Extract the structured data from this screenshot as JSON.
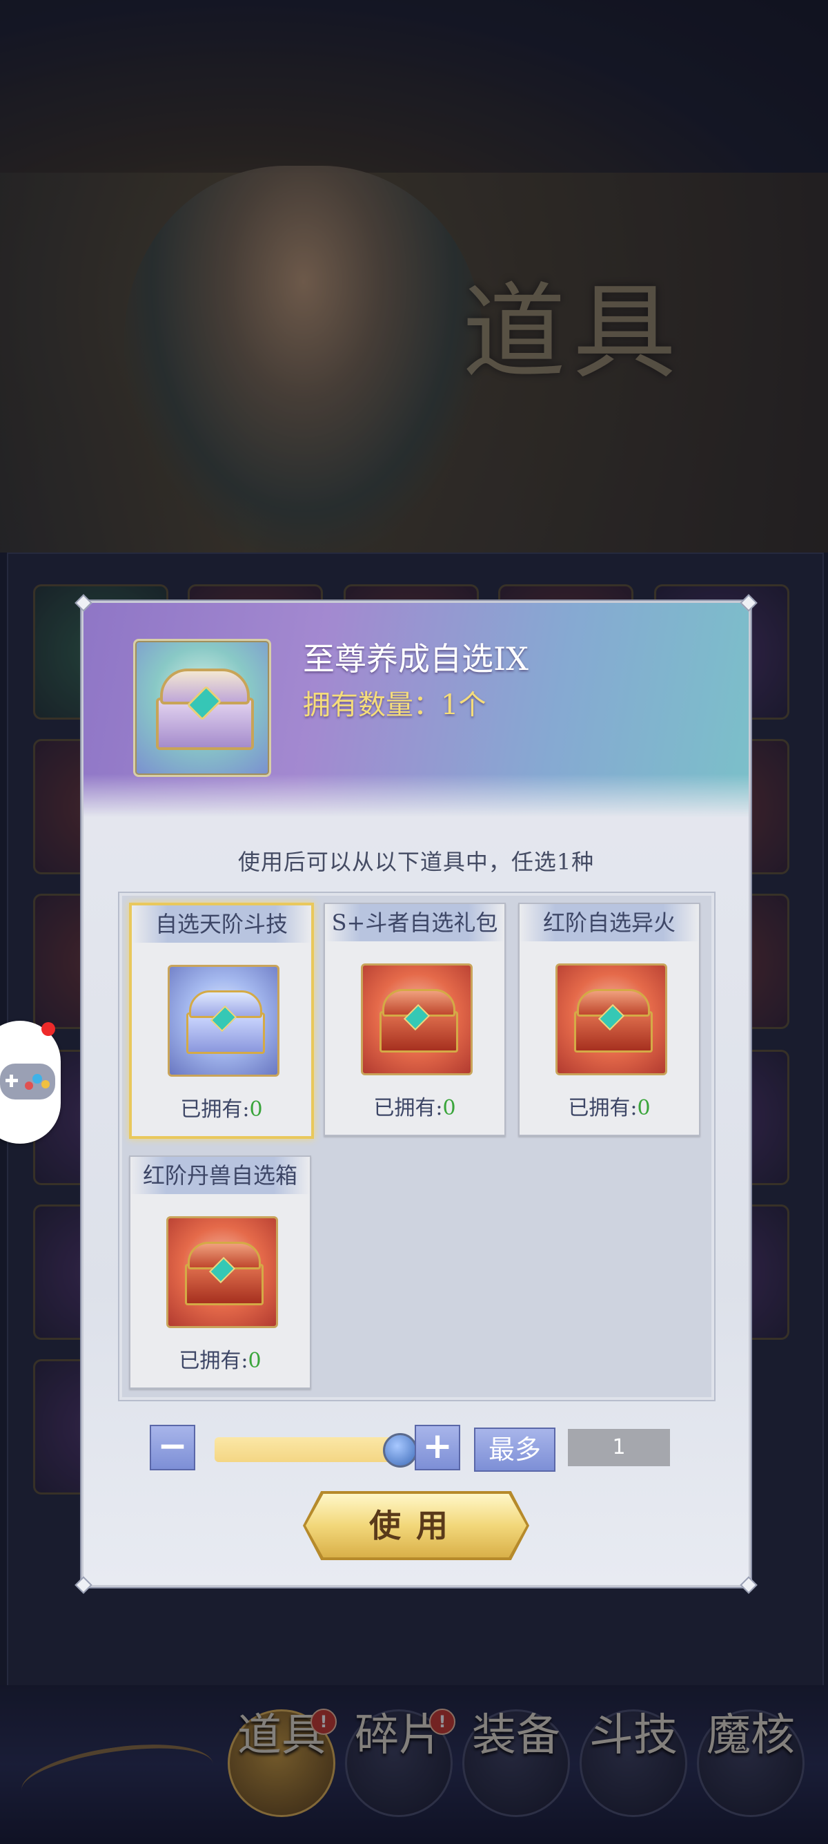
{
  "background": {
    "banner_title": "道具"
  },
  "dialog": {
    "item_name": "至尊养成自选IX",
    "owned_text": "拥有数量：1个",
    "hint": "使用后可以从以下道具中，任选1种",
    "options": [
      {
        "name": "自选天阶斗技",
        "owned_label": "已拥有:",
        "owned_count": "0",
        "selected": true
      },
      {
        "name": "S+斗者自选礼包",
        "owned_label": "已拥有:",
        "owned_count": "0",
        "selected": false
      },
      {
        "name": "红阶自选异火",
        "owned_label": "已拥有:",
        "owned_count": "0",
        "selected": false
      },
      {
        "name": "红阶丹兽自选箱",
        "owned_label": "已拥有:",
        "owned_count": "0",
        "selected": false
      }
    ],
    "quantity": {
      "minus_icon": "minus",
      "plus_icon": "plus",
      "max_label": "最多",
      "value": "1",
      "slider_fraction": 1.0
    },
    "use_button": "使用"
  },
  "bottom_nav": [
    {
      "label": "道具",
      "active": true,
      "badge": "!"
    },
    {
      "label": "碎片",
      "active": false,
      "badge": "!"
    },
    {
      "label": "装备",
      "active": false,
      "badge": ""
    },
    {
      "label": "斗技",
      "active": false,
      "badge": ""
    },
    {
      "label": "魔核",
      "active": false,
      "badge": ""
    }
  ],
  "colors": {
    "accent_gold": "#f5dd7a",
    "owned_green": "#3aa53b",
    "badge_red": "#c8382c"
  }
}
